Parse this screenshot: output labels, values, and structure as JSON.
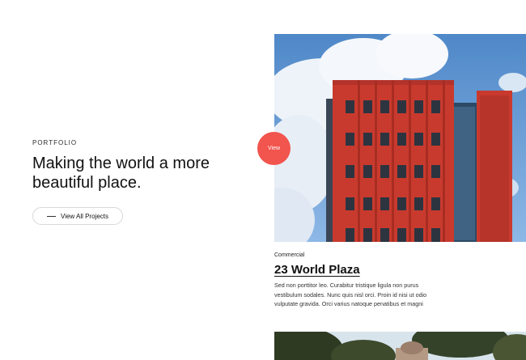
{
  "hero": {
    "eyebrow": "PORTFOLIO",
    "headline": "Making the world a more beautiful place.",
    "cta_label": "View All Projects"
  },
  "project": {
    "view_label": "View",
    "category": "Commercial",
    "title": "23 World Plaza",
    "description": "Sed non porttitor leo. Curabitur tristique ligula non purus vestibulum sodales. Nunc quis nisl orci. Proin id nisi ut odio vulputate gravida. Orci varius natoque penatibus et magni"
  },
  "colors": {
    "accent": "#f2544e",
    "building": "#c93a2e",
    "sky": "#6a9fd6"
  }
}
